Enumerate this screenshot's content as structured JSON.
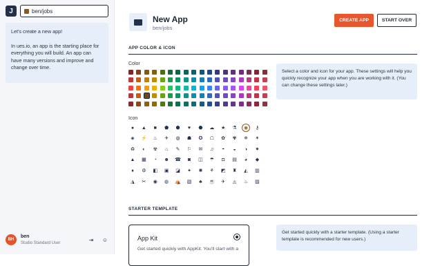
{
  "sidebar": {
    "logo_label": "J",
    "path": "ben/jobs",
    "chat": [
      "Let's create a new app!",
      "In ues.io, an app is the starting place for everything you will build. An app can have many versions and improve and change over time."
    ],
    "user": {
      "initials": "BH",
      "name": "ben",
      "role": "Studio Standard User",
      "logout_icon": "logout-icon",
      "profile_icon": "user-circle-icon"
    }
  },
  "header": {
    "title": "New App",
    "subtitle": "ben/jobs",
    "create_label": "CREATE APP",
    "start_over_label": "START OVER"
  },
  "app_color_icon": {
    "section_title": "APP COLOR & ICON",
    "color_label": "Color",
    "icon_label": "Icon",
    "info": "Select a color and icon for your app. These settings will help you quickly recognize your app when you are working with it. (You can change these settings later.)",
    "selected_color": "#8a5a1b",
    "selected_icon": "work-icon"
  },
  "palette": {
    "columns": [
      "#ef4444",
      "#f97316",
      "#f59e0b",
      "#eab308",
      "#84cc16",
      "#22c55e",
      "#10b981",
      "#14b8a6",
      "#06b6d4",
      "#0ea5e9",
      "#3b82f6",
      "#6366f1",
      "#8b5cf6",
      "#a855f7",
      "#d946ef",
      "#ec4899",
      "#f43f5e",
      "#f0546a"
    ],
    "rows": 5,
    "selected": {
      "row": 3,
      "col": 2
    }
  },
  "icons": [
    [
      "●",
      "▲",
      "■",
      "⬟",
      "⬢",
      "♥",
      "⬣",
      "☁",
      "★",
      "⚗",
      "◉",
      "⚷"
    ],
    [
      "◈",
      "⚡",
      "♨",
      "✈",
      "◍",
      "☗",
      "✪",
      "☖",
      "✿",
      "✾",
      "✵",
      "✶"
    ],
    [
      "♻",
      "◐",
      "☢",
      "⌂",
      "✎",
      "⚐",
      "✉",
      "♫",
      "◓",
      "◒",
      "◑",
      "✷"
    ],
    [
      "▲",
      "▦",
      "◔",
      "☻",
      "☎",
      "◙",
      "◫",
      "☂",
      "◘",
      "▤",
      "◕",
      "◆"
    ],
    [
      "♦",
      "⚙",
      "◧",
      "▣",
      "◪",
      "✦",
      "✺",
      "⚘",
      "◩",
      "♜",
      "◭",
      "▥"
    ],
    [
      "◮",
      "✂",
      "◉",
      "◍",
      "⛺",
      "▧",
      "♣",
      "☕",
      "✈",
      "◬",
      "♨",
      "▨"
    ]
  ],
  "starter": {
    "section_title": "STARTER TEMPLATE",
    "card_title": "App Kit",
    "card_desc": "Get started quickly with AppKit. You'll start with a",
    "info": "Get started quickly with a starter template. (Using a starter template is recommended for new users.)"
  }
}
